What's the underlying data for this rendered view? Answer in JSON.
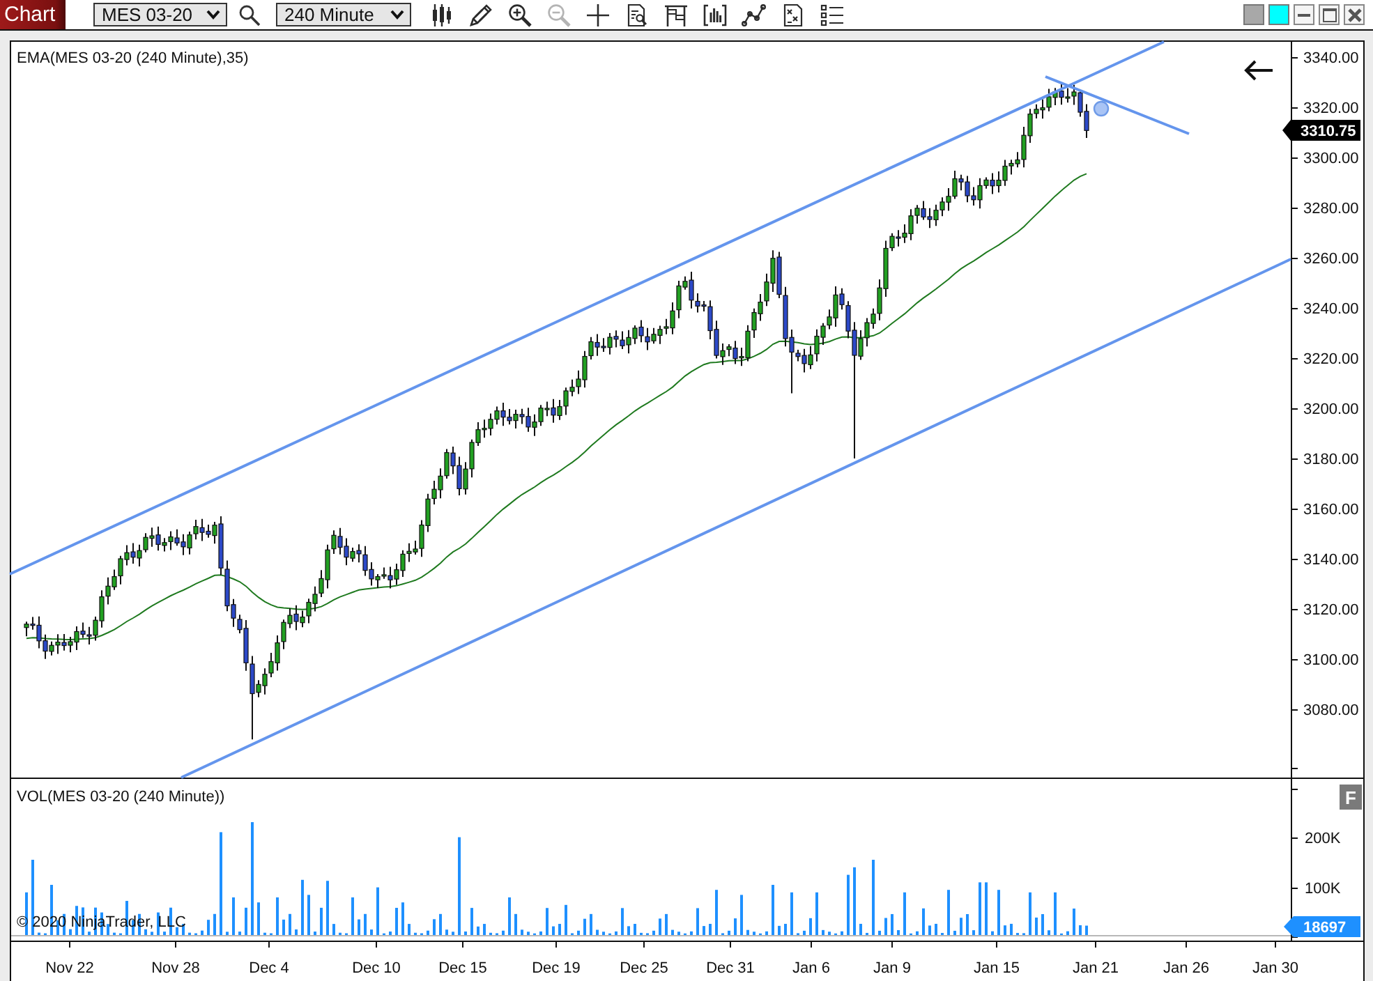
{
  "toolbar": {
    "tab": "Chart",
    "instrument": "MES 03-20",
    "interval": "240 Minute",
    "tools": [
      {
        "disabled": false
      },
      {
        "disabled": false
      },
      {
        "disabled": false
      },
      {
        "disabled": true
      },
      {
        "disabled": false
      },
      {
        "disabled": false
      },
      {
        "disabled": false
      },
      {
        "disabled": false
      },
      {
        "disabled": false
      },
      {
        "disabled": false
      },
      {
        "disabled": false
      }
    ],
    "swatches": [
      {
        "color": "#a8a8a8"
      },
      {
        "color": "#00ffff"
      }
    ]
  },
  "price_panel": {
    "label": "EMA(MES 03-20 (240 Minute),35)",
    "axis_labels": [
      "3340.00",
      "3320.00",
      "3300.00",
      "3280.00",
      "3260.00",
      "3240.00",
      "3220.00",
      "3200.00",
      "3180.00",
      "3160.00",
      "3140.00",
      "3120.00",
      "3100.00",
      "3080.00"
    ],
    "last_price": "3310.75"
  },
  "volume_panel": {
    "label": "VOL(MES 03-20 (240 Minute))",
    "axis_labels": [
      "200K",
      "100K"
    ],
    "last_volume": "18697",
    "button": "F",
    "copyright": "© 2020 NinjaTrader, LLC"
  },
  "time_axis": [
    "Nov 22",
    "Nov 28",
    "Dec 4",
    "Dec 10",
    "Dec 15",
    "Dec 19",
    "Dec 25",
    "Dec 31",
    "Jan 6",
    "Jan 9",
    "Jan 15",
    "Jan 21",
    "Jan 26",
    "Jan 30"
  ]
}
